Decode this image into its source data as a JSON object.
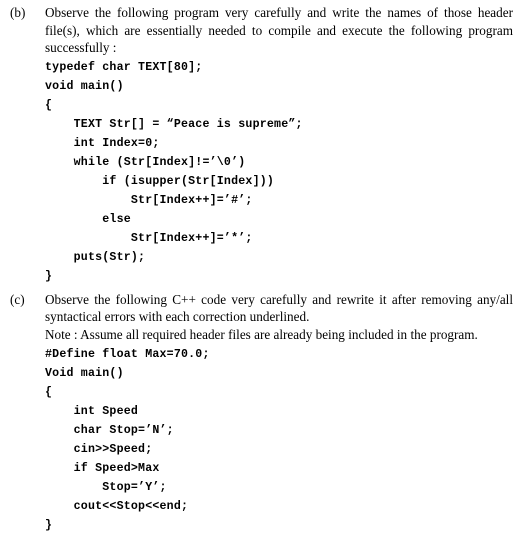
{
  "document": {
    "sections": [
      {
        "label": "(b)",
        "paragraphs": [
          "Observe the following program very carefully and write the names of those header file(s), which are essentially needed to compile and execute the following program successfully :"
        ],
        "code_lines": [
          "typedef char TEXT[80];",
          "void main()",
          "{",
          "    TEXT Str[] = “Peace is supreme”;",
          "    int Index=0;",
          "    while (Str[Index]!=’\\0’)",
          "        if (isupper(Str[Index]))",
          "            Str[Index++]=’#’;",
          "        else",
          "            Str[Index++]=’*’;",
          "    puts(Str);",
          "}"
        ]
      },
      {
        "label": "(c)",
        "paragraphs": [
          "Observe the following C++ code very carefully and rewrite it after removing any/all syntactical errors with each correction underlined."
        ],
        "note": "Note : Assume all required header files are already being included in the program.",
        "code_lines": [
          "#Define float Max=70.0;",
          "Void main()",
          "{",
          "    int Speed",
          "    char Stop=’N’;",
          "    cin>>Speed;",
          "    if Speed>Max",
          "        Stop=’Y’;",
          "    cout<<Stop<<end;",
          "}"
        ]
      }
    ]
  }
}
